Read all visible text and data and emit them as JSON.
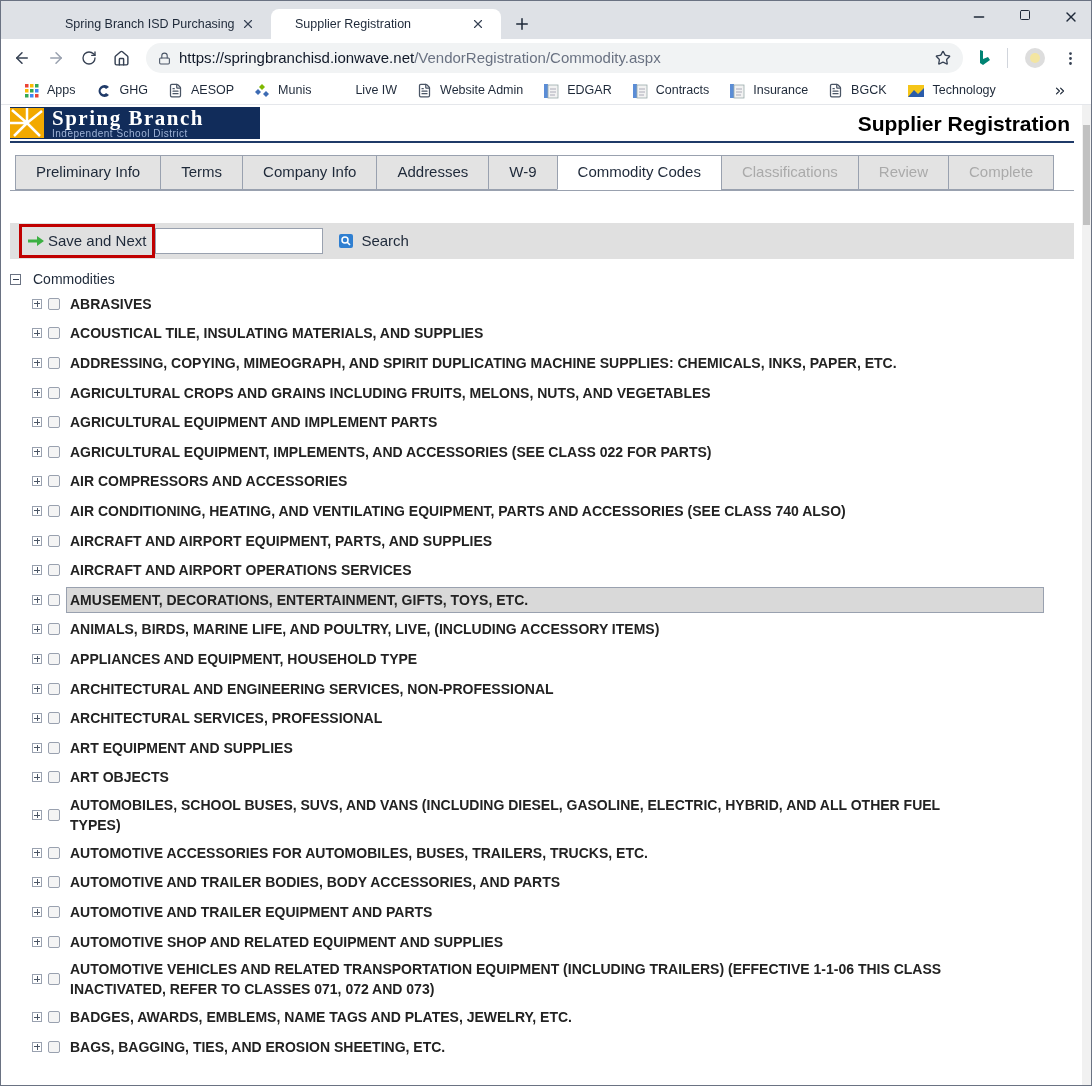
{
  "browser": {
    "tabs": [
      {
        "title": "Spring Branch ISD Purchasing",
        "selected": false
      },
      {
        "title": "Supplier Registration",
        "selected": true
      }
    ],
    "url": {
      "host": "https://springbranchisd.ionwave.net",
      "path": "/VendorRegistration/Commodity.aspx"
    },
    "bookmarks": [
      {
        "label": "Apps",
        "kind": "apps"
      },
      {
        "label": "GHG",
        "kind": "logo"
      },
      {
        "label": "AESOP",
        "kind": "page"
      },
      {
        "label": "Munis",
        "kind": "munis"
      },
      {
        "label": "Live IW",
        "kind": "none"
      },
      {
        "label": "Website Admin",
        "kind": "page"
      },
      {
        "label": "EDGAR",
        "kind": "doc"
      },
      {
        "label": "Contracts",
        "kind": "doc"
      },
      {
        "label": "Insurance",
        "kind": "doc"
      },
      {
        "label": "BGCK",
        "kind": "page"
      },
      {
        "label": "Technology",
        "kind": "folder"
      }
    ]
  },
  "header": {
    "logo_title": "Spring Branch",
    "logo_subtitle": "Independent School District",
    "page_title": "Supplier Registration"
  },
  "tabs": [
    {
      "label": "Preliminary Info",
      "selected": false,
      "disabled": false
    },
    {
      "label": "Terms",
      "selected": false,
      "disabled": false
    },
    {
      "label": "Company Info",
      "selected": false,
      "disabled": false
    },
    {
      "label": "Addresses",
      "selected": false,
      "disabled": false
    },
    {
      "label": "W-9",
      "selected": false,
      "disabled": false
    },
    {
      "label": "Commodity Codes",
      "selected": true,
      "disabled": false
    },
    {
      "label": "Classifications",
      "selected": false,
      "disabled": true
    },
    {
      "label": "Review",
      "selected": false,
      "disabled": true
    },
    {
      "label": "Complete",
      "selected": false,
      "disabled": true
    }
  ],
  "toolbar": {
    "save_button": "Save and Next",
    "search_button": "Search"
  },
  "tree": {
    "root": "Commodities",
    "expanded": true,
    "items": [
      {
        "label": "ABRASIVES",
        "checked": false,
        "selected": false
      },
      {
        "label": "ACOUSTICAL TILE, INSULATING MATERIALS, AND SUPPLIES",
        "checked": false,
        "selected": false
      },
      {
        "label": "ADDRESSING, COPYING, MIMEOGRAPH, AND SPIRIT DUPLICATING MACHINE SUPPLIES: CHEMICALS, INKS, PAPER, ETC.",
        "checked": false,
        "selected": false
      },
      {
        "label": "AGRICULTURAL CROPS AND GRAINS INCLUDING FRUITS, MELONS, NUTS, AND VEGETABLES",
        "checked": false,
        "selected": false
      },
      {
        "label": "AGRICULTURAL EQUIPMENT AND IMPLEMENT PARTS",
        "checked": false,
        "selected": false
      },
      {
        "label": "AGRICULTURAL EQUIPMENT, IMPLEMENTS, AND ACCESSORIES (SEE CLASS 022 FOR PARTS)",
        "checked": false,
        "selected": false
      },
      {
        "label": "AIR COMPRESSORS AND ACCESSORIES",
        "checked": false,
        "selected": false
      },
      {
        "label": "AIR CONDITIONING, HEATING, AND VENTILATING EQUIPMENT, PARTS AND ACCESSORIES (SEE CLASS 740 ALSO)",
        "checked": false,
        "selected": false
      },
      {
        "label": "AIRCRAFT AND AIRPORT EQUIPMENT, PARTS, AND SUPPLIES",
        "checked": false,
        "selected": false
      },
      {
        "label": "AIRCRAFT AND AIRPORT OPERATIONS SERVICES",
        "checked": false,
        "selected": false
      },
      {
        "label": "AMUSEMENT, DECORATIONS, ENTERTAINMENT, GIFTS, TOYS, ETC.",
        "checked": false,
        "selected": true
      },
      {
        "label": "ANIMALS, BIRDS, MARINE LIFE, AND POULTRY, LIVE, (INCLUDING ACCESSORY ITEMS)",
        "checked": false,
        "selected": false
      },
      {
        "label": "APPLIANCES AND EQUIPMENT, HOUSEHOLD TYPE",
        "checked": false,
        "selected": false
      },
      {
        "label": "ARCHITECTURAL AND ENGINEERING SERVICES, NON-PROFESSIONAL",
        "checked": false,
        "selected": false
      },
      {
        "label": "ARCHITECTURAL SERVICES, PROFESSIONAL",
        "checked": false,
        "selected": false
      },
      {
        "label": "ART EQUIPMENT AND SUPPLIES",
        "checked": false,
        "selected": false
      },
      {
        "label": "ART OBJECTS",
        "checked": false,
        "selected": false
      },
      {
        "label": "AUTOMOBILES, SCHOOL BUSES, SUVS, AND VANS (INCLUDING DIESEL, GASOLINE, ELECTRIC, HYBRID, AND ALL OTHER FUEL TYPES)",
        "checked": false,
        "selected": false
      },
      {
        "label": "AUTOMOTIVE ACCESSORIES FOR AUTOMOBILES, BUSES, TRAILERS, TRUCKS, ETC.",
        "checked": false,
        "selected": false
      },
      {
        "label": "AUTOMOTIVE AND TRAILER BODIES, BODY ACCESSORIES, AND PARTS",
        "checked": false,
        "selected": false
      },
      {
        "label": "AUTOMOTIVE AND TRAILER EQUIPMENT AND PARTS",
        "checked": false,
        "selected": false
      },
      {
        "label": "AUTOMOTIVE SHOP AND RELATED EQUIPMENT AND SUPPLIES",
        "checked": false,
        "selected": false
      },
      {
        "label": "AUTOMOTIVE VEHICLES AND RELATED TRANSPORTATION EQUIPMENT (INCLUDING TRAILERS) (EFFECTIVE 1-1-06 THIS CLASS INACTIVATED, REFER TO CLASSES 071, 072 AND 073)",
        "checked": false,
        "selected": false
      },
      {
        "label": "BADGES, AWARDS, EMBLEMS, NAME TAGS AND PLATES, JEWELRY, ETC.",
        "checked": false,
        "selected": false
      },
      {
        "label": "BAGS, BAGGING, TIES, AND EROSION SHEETING, ETC.",
        "checked": false,
        "selected": false
      }
    ]
  }
}
